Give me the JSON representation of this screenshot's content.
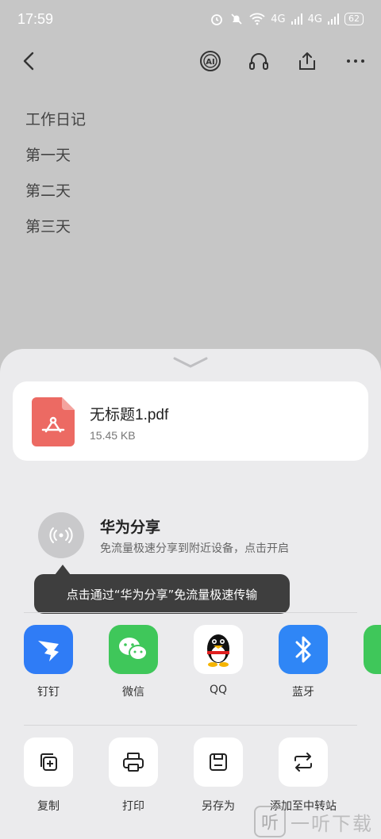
{
  "status_bar": {
    "time": "17:59",
    "network_1": "4G",
    "network_2": "4G",
    "battery": "62"
  },
  "toolbar": {
    "icons": [
      "back-icon",
      "ai-icon",
      "headphones-icon",
      "share-icon",
      "more-icon"
    ]
  },
  "document": {
    "lines": [
      "工作日记",
      "第一天",
      "第二天",
      "第三天"
    ]
  },
  "share_sheet": {
    "file": {
      "name": "无标题1.pdf",
      "size": "15.45 KB",
      "icon": "pdf-icon",
      "icon_color": "#ec6a63"
    },
    "huawei_share": {
      "title": "华为分享",
      "description": "免流量极速分享到附近设备，点击开启"
    },
    "tooltip": "点击通过“华为分享”免流量极速传输",
    "apps": [
      {
        "label": "钉钉",
        "icon": "dingtalk-icon",
        "color": "#2f7cf6"
      },
      {
        "label": "微信",
        "icon": "wechat-icon",
        "color": "#3fc75a"
      },
      {
        "label": "QQ",
        "icon": "qq-icon",
        "color": "#ffffff"
      },
      {
        "label": "蓝牙",
        "icon": "bluetooth-icon",
        "color": "#2f86f6"
      },
      {
        "label": "",
        "icon": "partial-app-icon",
        "color": "#3fc75a"
      }
    ],
    "actions": [
      {
        "label": "复制",
        "icon": "copy-icon"
      },
      {
        "label": "打印",
        "icon": "print-icon"
      },
      {
        "label": "另存为",
        "icon": "save-icon"
      },
      {
        "label": "添加至中转站",
        "icon": "transfer-icon"
      }
    ]
  },
  "watermark": {
    "mark": "听",
    "text": "一听下载"
  }
}
